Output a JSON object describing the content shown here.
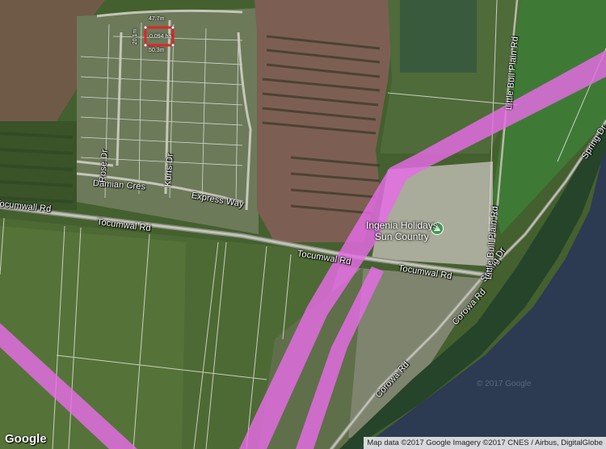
{
  "map": {
    "provider_logo": "Google",
    "attribution": "Map data ©2017 Google  Imagery ©2017 CNES / Airbus, DigitalGlobe",
    "watermark": "© 2017 Google",
    "overlay_color": "#e66be6",
    "selection_color": "#e0242b",
    "measurements": {
      "top": "47.7m",
      "left": "20.1m",
      "area": "0.094 ha",
      "bottom": "50.3m"
    },
    "roads": [
      {
        "label": "Tocumwall Rd"
      },
      {
        "label": "Tocumwal Rd"
      },
      {
        "label": "Tocumwal Rd"
      },
      {
        "label": "Tocumwal Rd"
      },
      {
        "label": "Corowa Rd"
      },
      {
        "label": "Corowa Rd"
      },
      {
        "label": "Spring Dr"
      },
      {
        "label": "Spring Dr"
      },
      {
        "label": "Little Bull Plain Rd"
      },
      {
        "label": "Little Bull Plain Rd"
      },
      {
        "label": "Express Way"
      },
      {
        "label": "Damian Cres"
      },
      {
        "label": "Rose Dr"
      },
      {
        "label": "Kurts Dr"
      }
    ],
    "poi": {
      "name_line1": "Ingenia Holidays",
      "name_line2": "Sun Country",
      "icon": "campground-icon"
    }
  }
}
